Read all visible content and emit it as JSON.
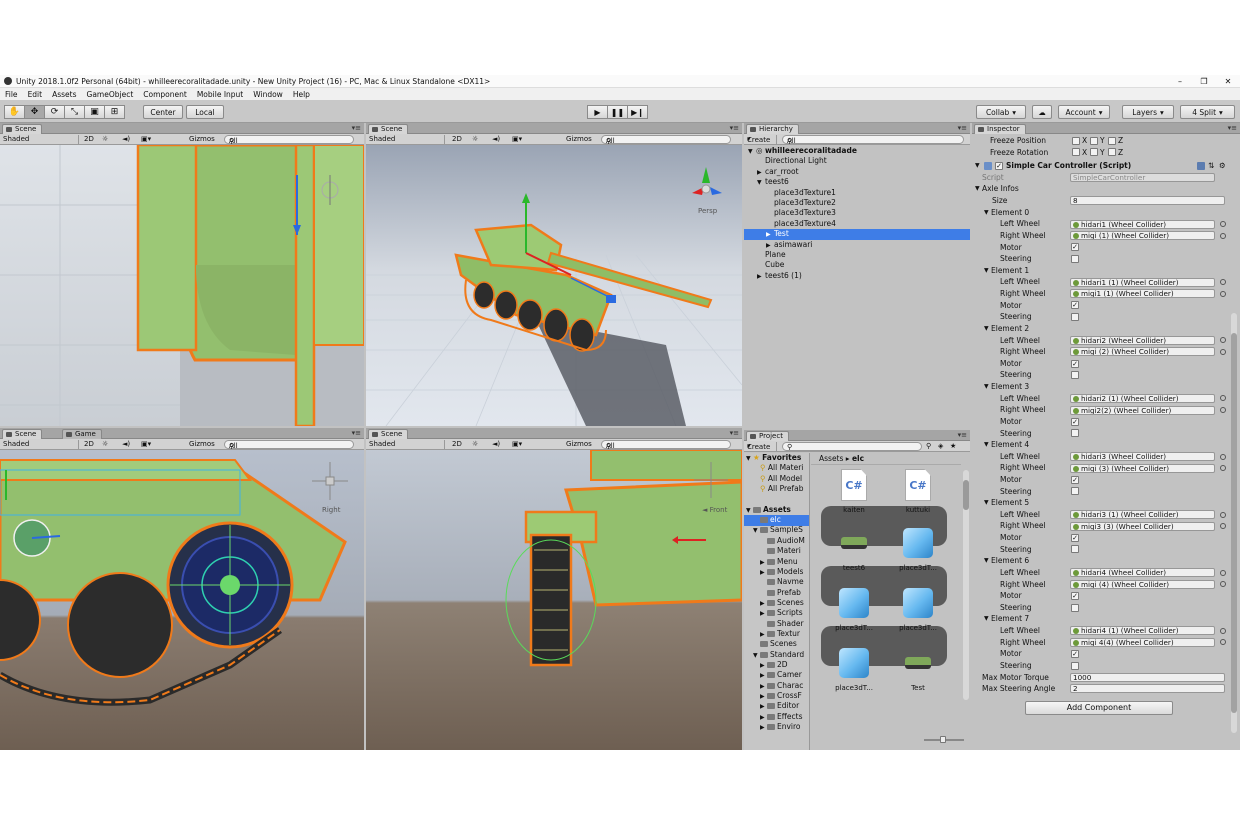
{
  "window": {
    "title": "Unity 2018.1.0f2 Personal (64bit) - whilleerecoralitadade.unity - New Unity Project (16) - PC, Mac & Linux Standalone <DX11>"
  },
  "menubar": [
    "File",
    "Edit",
    "Assets",
    "GameObject",
    "Component",
    "Mobile Input",
    "Window",
    "Help"
  ],
  "toolbar": {
    "center": "Center",
    "local": "Local",
    "collab": "Collab",
    "account": "Account",
    "layers": "Layers",
    "layout": "4 Split"
  },
  "scene_views": {
    "tab_scene": "Scene",
    "tab_game": "Game",
    "shaded": "Shaded",
    "two_d": "2D",
    "gizmos": "Gizmos",
    "search": "All",
    "persp": "Persp",
    "right": "Right"
  },
  "hierarchy": {
    "tab": "Hierarchy",
    "create": "Create",
    "search": "All",
    "items": [
      {
        "label": "whilleerecoralitadade",
        "depth": 0,
        "bold": true,
        "arrow": "▼"
      },
      {
        "label": "Directional Light",
        "depth": 1,
        "arrow": ""
      },
      {
        "label": "car_rroot",
        "depth": 1,
        "arrow": "▶"
      },
      {
        "label": "teest6",
        "depth": 1,
        "arrow": "▼"
      },
      {
        "label": "place3dTexture1",
        "depth": 2,
        "arrow": ""
      },
      {
        "label": "place3dTexture2",
        "depth": 2,
        "arrow": ""
      },
      {
        "label": "place3dTexture3",
        "depth": 2,
        "arrow": ""
      },
      {
        "label": "place3dTexture4",
        "depth": 2,
        "arrow": ""
      },
      {
        "label": "Test",
        "depth": 2,
        "arrow": "▶",
        "selected": true
      },
      {
        "label": "asimawari",
        "depth": 2,
        "arrow": "▶"
      },
      {
        "label": "Plane",
        "depth": 1,
        "arrow": ""
      },
      {
        "label": "Cube",
        "depth": 1,
        "arrow": ""
      },
      {
        "label": "teest6 (1)",
        "depth": 1,
        "arrow": "▶"
      }
    ]
  },
  "project": {
    "tab": "Project",
    "create": "Create",
    "breadcrumb": [
      "Assets",
      "elc"
    ],
    "tree": [
      {
        "label": "Favorites",
        "depth": 0,
        "arrow": "▼",
        "kind": "fav",
        "bold": true
      },
      {
        "label": "All Materi",
        "depth": 1,
        "kind": "search"
      },
      {
        "label": "All Model",
        "depth": 1,
        "kind": "search"
      },
      {
        "label": "All Prefab",
        "depth": 1,
        "kind": "search"
      },
      {
        "label": "",
        "depth": 0,
        "kind": "gap"
      },
      {
        "label": "Assets",
        "depth": 0,
        "arrow": "▼",
        "kind": "folder",
        "bold": true
      },
      {
        "label": "elc",
        "depth": 1,
        "kind": "folder",
        "selected": true
      },
      {
        "label": "SampleS",
        "depth": 1,
        "arrow": "▼",
        "kind": "folder"
      },
      {
        "label": "AudioM",
        "depth": 2,
        "kind": "folder"
      },
      {
        "label": "Materi",
        "depth": 2,
        "kind": "folder"
      },
      {
        "label": "Menu",
        "depth": 2,
        "arrow": "▶",
        "kind": "folder"
      },
      {
        "label": "Models",
        "depth": 2,
        "arrow": "▶",
        "kind": "folder"
      },
      {
        "label": "Navme",
        "depth": 2,
        "kind": "folder"
      },
      {
        "label": "Prefab",
        "depth": 2,
        "kind": "folder"
      },
      {
        "label": "Scenes",
        "depth": 2,
        "arrow": "▶",
        "kind": "folder"
      },
      {
        "label": "Scripts",
        "depth": 2,
        "arrow": "▶",
        "kind": "folder"
      },
      {
        "label": "Shader",
        "depth": 2,
        "kind": "folder"
      },
      {
        "label": "Textur",
        "depth": 2,
        "arrow": "▶",
        "kind": "folder"
      },
      {
        "label": "Scenes",
        "depth": 1,
        "kind": "folder"
      },
      {
        "label": "Standard",
        "depth": 1,
        "arrow": "▼",
        "kind": "folder"
      },
      {
        "label": "2D",
        "depth": 2,
        "arrow": "▶",
        "kind": "folder"
      },
      {
        "label": "Camer",
        "depth": 2,
        "arrow": "▶",
        "kind": "folder"
      },
      {
        "label": "Charac",
        "depth": 2,
        "arrow": "▶",
        "kind": "folder"
      },
      {
        "label": "CrossF",
        "depth": 2,
        "arrow": "▶",
        "kind": "folder"
      },
      {
        "label": "Editor",
        "depth": 2,
        "arrow": "▶",
        "kind": "folder"
      },
      {
        "label": "Effects",
        "depth": 2,
        "arrow": "▶",
        "kind": "folder"
      },
      {
        "label": "Enviro",
        "depth": 2,
        "arrow": "▶",
        "kind": "folder"
      }
    ],
    "assets": [
      {
        "label": "kaiten",
        "kind": "script"
      },
      {
        "label": "kuttuki",
        "kind": "script"
      },
      {
        "label": "teest6",
        "kind": "tank"
      },
      {
        "label": "place3dT...",
        "kind": "cube"
      },
      {
        "label": "place3dT...",
        "kind": "cube"
      },
      {
        "label": "place3dT...",
        "kind": "cube"
      },
      {
        "label": "place3dT...",
        "kind": "cube"
      },
      {
        "label": "Test",
        "kind": "tank"
      }
    ]
  },
  "inspector": {
    "tab": "Inspector",
    "freeze_position": "Freeze Position",
    "freeze_rotation": "Freeze Rotation",
    "axis_x": "X",
    "axis_y": "Y",
    "axis_z": "Z",
    "component": "Simple Car Controller (Script)",
    "script_label": "Script",
    "script_value": "SimpleCarController",
    "axle_infos": "Axle Infos",
    "size_label": "Size",
    "size_value": "8",
    "left_wheel": "Left Wheel",
    "right_wheel": "Right Wheel",
    "motor": "Motor",
    "steering": "Steering",
    "elements": [
      {
        "name": "Element 0",
        "left": "hidari1 (Wheel Collider)",
        "right": "migi (1) (Wheel Collider)",
        "motor": true,
        "steering": false
      },
      {
        "name": "Element 1",
        "left": "hidari1 (1) (Wheel Collider)",
        "right": "migi1 (1) (Wheel Collider)",
        "motor": true,
        "steering": false
      },
      {
        "name": "Element 2",
        "left": "hidari2 (Wheel Collider)",
        "right": "migi (2) (Wheel Collider)",
        "motor": true,
        "steering": false
      },
      {
        "name": "Element 3",
        "left": "hidari2 (1) (Wheel Collider)",
        "right": "migi2(2) (Wheel Collider)",
        "motor": true,
        "steering": false
      },
      {
        "name": "Element 4",
        "left": "hidari3 (Wheel Collider)",
        "right": "migi (3) (Wheel Collider)",
        "motor": true,
        "steering": false
      },
      {
        "name": "Element 5",
        "left": "hidari3 (1) (Wheel Collider)",
        "right": "migi3 (3) (Wheel Collider)",
        "motor": true,
        "steering": false
      },
      {
        "name": "Element 6",
        "left": "hidari4 (Wheel Collider)",
        "right": "migi (4) (Wheel Collider)",
        "motor": true,
        "steering": false
      },
      {
        "name": "Element 7",
        "left": "hidari4 (1) (Wheel Collider)",
        "right": "migi 4(4) (Wheel Collider)",
        "motor": true,
        "steering": false
      }
    ],
    "max_motor_torque_label": "Max Motor Torque",
    "max_motor_torque": "1000",
    "max_steering_angle_label": "Max Steering Angle",
    "max_steering_angle": "2",
    "add_component": "Add Component"
  },
  "colors": {
    "selection": "#3e7de7",
    "tank_green": "#93bf6e",
    "outline": "#f07a1a",
    "sky": "#a8b4c6",
    "ground": "#7a6a5c"
  }
}
